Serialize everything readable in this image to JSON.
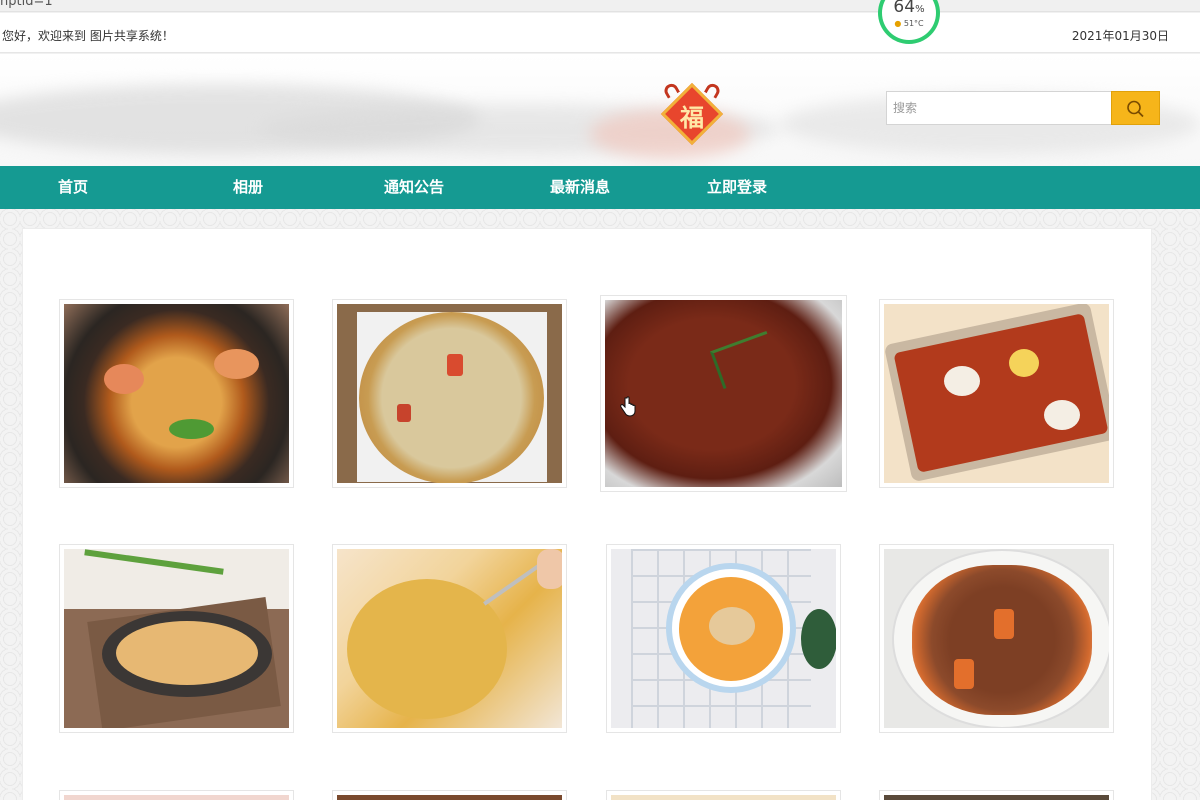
{
  "browser": {
    "url_fragment": "nptid=1"
  },
  "topbar": {
    "welcome": "您好，欢迎来到 图片共享系统！",
    "date": "2021年01月30日"
  },
  "overlay_gauge": {
    "percent": "64",
    "percent_unit": "%",
    "temperature": "51°C"
  },
  "header": {
    "logo_char": "福",
    "search": {
      "placeholder": "搜索"
    }
  },
  "nav": {
    "items": [
      {
        "label": "首页"
      },
      {
        "label": "相册"
      },
      {
        "label": "通知公告"
      },
      {
        "label": "最新消息"
      },
      {
        "label": "立即登录"
      }
    ]
  },
  "gallery": {
    "photos": [
      {
        "subject": "seafood hotpot"
      },
      {
        "subject": "pizza"
      },
      {
        "subject": "spicy crayfish"
      },
      {
        "subject": "crayfish tray with lotus root"
      },
      {
        "subject": "noodles"
      },
      {
        "subject": "golden fried rice"
      },
      {
        "subject": "noodle soup"
      },
      {
        "subject": "braised beef rice"
      },
      {
        "subject": "photo"
      },
      {
        "subject": "photo"
      },
      {
        "subject": "photo"
      },
      {
        "subject": "photo"
      }
    ]
  },
  "colors": {
    "nav_bg": "#159a92",
    "search_button": "#f6b51a",
    "accent_green": "#2ecc71"
  },
  "icons": [
    "search-icon",
    "fu-logo",
    "hand-cursor-icon",
    "flame-icon"
  ]
}
